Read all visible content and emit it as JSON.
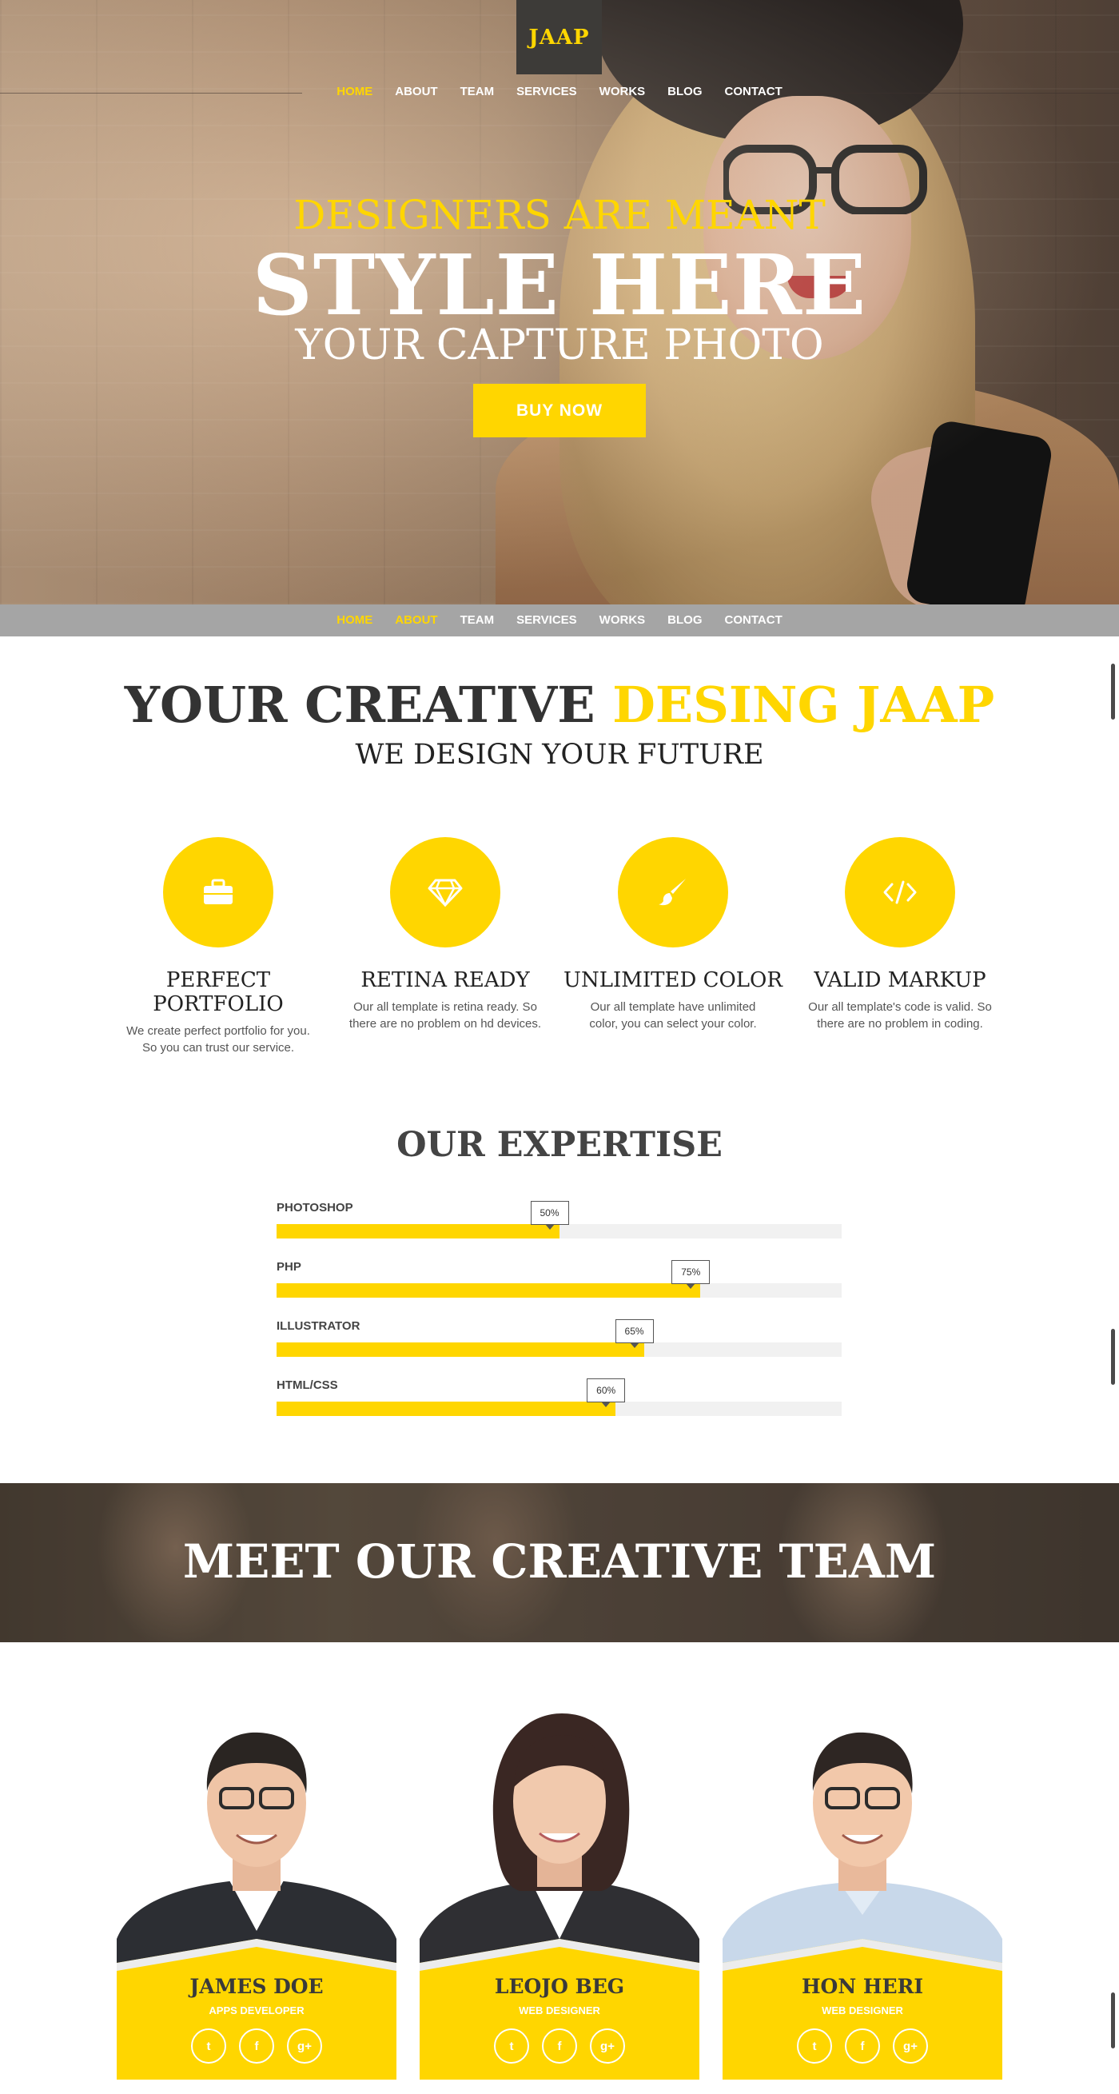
{
  "brand": {
    "logo": "JAAP"
  },
  "nav": {
    "items": [
      "HOME",
      "ABOUT",
      "TEAM",
      "SERVICES",
      "WORKS",
      "BLOG",
      "CONTACT"
    ],
    "hero_active": "HOME",
    "subnav_active": [
      "HOME",
      "ABOUT"
    ]
  },
  "hero": {
    "line1": "DESIGNERS ARE MEANT",
    "headline": "STYLE HERE",
    "line3": "YOUR CAPTURE PHOTO",
    "cta": "BUY NOW"
  },
  "about": {
    "title_part1": "YOUR CREATIVE ",
    "title_highlight": "DESING JAAP",
    "subtitle": "WE DESIGN YOUR FUTURE",
    "features": [
      {
        "icon": "briefcase-icon",
        "title": "PERFECT PORTFOLIO",
        "line1": "We create perfect portfolio for you.",
        "line2": "So you can trust our service."
      },
      {
        "icon": "diamond-icon",
        "title": "RETINA READY",
        "line1": "Our all template is retina ready. So",
        "line2": "there are no problem on hd devices."
      },
      {
        "icon": "brush-icon",
        "title": "UNLIMITED COLOR",
        "line1": "Our all template have unlimited",
        "line2": "color, you can select your color."
      },
      {
        "icon": "code-icon",
        "title": "VALID MARKUP",
        "line1": "Our all template's code is valid. So",
        "line2": "there are no problem in coding."
      }
    ]
  },
  "expertise": {
    "title": "OUR EXPERTISE",
    "skills": [
      {
        "name": "PHOTOSHOP",
        "percent": 50,
        "label": "50%"
      },
      {
        "name": "PHP",
        "percent": 75,
        "label": "75%"
      },
      {
        "name": "ILLUSTRATOR",
        "percent": 65,
        "label": "65%"
      },
      {
        "name": "HTML/CSS",
        "percent": 60,
        "label": "60%"
      }
    ]
  },
  "team": {
    "banner_title": "MEET OUR CREATIVE TEAM",
    "members": [
      {
        "name": "JAMES DOE",
        "role": "APPS DEVELOPER"
      },
      {
        "name": "LEOJO BEG",
        "role": "WEB DESIGNER"
      },
      {
        "name": "HON HERI",
        "role": "WEB DESIGNER"
      }
    ],
    "social_icons": [
      "twitter-icon",
      "facebook-icon",
      "google-plus-icon"
    ]
  },
  "colors": {
    "accent": "#ffd600",
    "dark": "#3d3b38",
    "subnav": "#a5a5a5"
  }
}
